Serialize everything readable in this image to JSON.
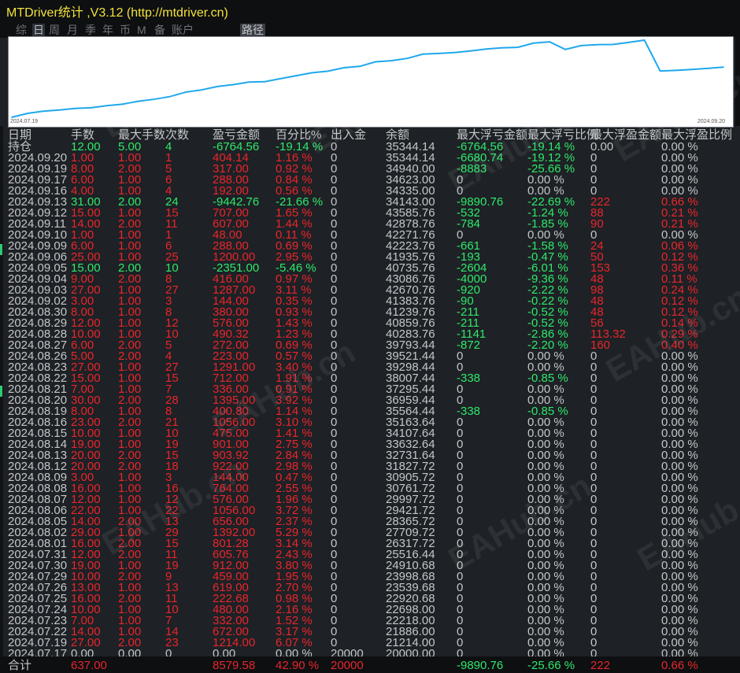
{
  "window": {
    "title": "MTDriver统计 ,V3.12 (http://mtdriver.cn)"
  },
  "tabs": [
    {
      "label": "综",
      "active": false
    },
    {
      "label": "日",
      "active": true
    },
    {
      "label": "周",
      "active": false
    },
    {
      "label": "月",
      "active": false
    },
    {
      "label": "季",
      "active": false
    },
    {
      "label": "年",
      "active": false
    },
    {
      "label": "币",
      "active": false
    },
    {
      "label": "M",
      "active": false
    },
    {
      "label": "备",
      "active": false
    },
    {
      "label": "账户",
      "active": false
    }
  ],
  "route_tab": "路径",
  "chart": {
    "start_date": "2024.07.19",
    "end_date": "2024.09.20",
    "line_color": "#1fa8ec",
    "balance": [
      20000.0,
      21214.0,
      21886.0,
      22218.0,
      22698.0,
      22920.68,
      23539.68,
      23998.68,
      24910.68,
      25516.44,
      26317.72,
      27709.72,
      28365.72,
      29421.72,
      29997.72,
      30761.72,
      30905.72,
      31827.72,
      32731.64,
      33632.64,
      34107.64,
      35163.64,
      35564.44,
      36959.44,
      37295.44,
      38007.44,
      39298.44,
      39521.44,
      39793.44,
      40283.76,
      40859.76,
      41239.76,
      41383.76,
      42670.76,
      43086.76,
      40735.76,
      41935.76,
      42223.76,
      42271.76,
      42878.76,
      43585.76,
      34143.0,
      34335.0,
      34623.0,
      34940.0,
      35344.14
    ]
  },
  "table": {
    "headers": [
      "日期",
      "手数",
      "最大手数",
      "次数",
      "盈亏金额",
      "百分比%",
      "出入金",
      "余额",
      "最大浮亏金额",
      "最大浮亏比例",
      "最大浮盈金额",
      "最大浮盈比例"
    ],
    "rows": [
      [
        "持仓",
        "12.00",
        "5.00",
        "4",
        "-6764.56",
        "-19.14 %",
        "0",
        "35344.14",
        "-6764.56",
        "-19.14 %",
        "0.00",
        "0.00 %"
      ],
      [
        "2024.09.20",
        "1.00",
        "1.00",
        "1",
        "404.14",
        "1.16 %",
        "0",
        "35344.14",
        "-6680.74",
        "-19.12 %",
        "0",
        "0.00 %"
      ],
      [
        "2024.09.19",
        "8.00",
        "2.00",
        "5",
        "317.00",
        "0.92 %",
        "0",
        "34940.00",
        "-8883",
        "-25.66 %",
        "0",
        "0.00 %"
      ],
      [
        "2024.09.17",
        "6.00",
        "1.00",
        "6",
        "288.00",
        "0.84 %",
        "0",
        "34623.00",
        "0",
        "0.00 %",
        "0",
        "0.00 %"
      ],
      [
        "2024.09.16",
        "4.00",
        "1.00",
        "4",
        "192.00",
        "0.56 %",
        "0",
        "34335.00",
        "0",
        "0.00 %",
        "0",
        "0.00 %"
      ],
      [
        "2024.09.13",
        "31.00",
        "2.00",
        "24",
        "-9442.76",
        "-21.66 %",
        "0",
        "34143.00",
        "-9890.76",
        "-22.69 %",
        "222",
        "0.66 %"
      ],
      [
        "2024.09.12",
        "15.00",
        "1.00",
        "15",
        "707.00",
        "1.65 %",
        "0",
        "43585.76",
        "-532",
        "-1.24 %",
        "88",
        "0.21 %"
      ],
      [
        "2024.09.11",
        "14.00",
        "2.00",
        "11",
        "607.00",
        "1.44 %",
        "0",
        "42878.76",
        "-784",
        "-1.85 %",
        "90",
        "0.21 %"
      ],
      [
        "2024.09.10",
        "1.00",
        "1.00",
        "1",
        "48.00",
        "0.11 %",
        "0",
        "42271.76",
        "0",
        "0.00 %",
        "0",
        "0.00 %"
      ],
      [
        "2024.09.09",
        "6.00",
        "1.00",
        "6",
        "288.00",
        "0.69 %",
        "0",
        "42223.76",
        "-661",
        "-1.58 %",
        "24",
        "0.06 %"
      ],
      [
        "2024.09.06",
        "25.00",
        "1.00",
        "25",
        "1200.00",
        "2.95 %",
        "0",
        "41935.76",
        "-193",
        "-0.47 %",
        "50",
        "0.12 %"
      ],
      [
        "2024.09.05",
        "15.00",
        "2.00",
        "10",
        "-2351.00",
        "-5.46 %",
        "0",
        "40735.76",
        "-2604",
        "-6.01 %",
        "153",
        "0.36 %"
      ],
      [
        "2024.09.04",
        "9.00",
        "2.00",
        "8",
        "416.00",
        "0.97 %",
        "0",
        "43086.76",
        "-4000",
        "-9.36 %",
        "48",
        "0.11 %"
      ],
      [
        "2024.09.03",
        "27.00",
        "1.00",
        "27",
        "1287.00",
        "3.11 %",
        "0",
        "42670.76",
        "-920",
        "-2.22 %",
        "98",
        "0.24 %"
      ],
      [
        "2024.09.02",
        "3.00",
        "1.00",
        "3",
        "144.00",
        "0.35 %",
        "0",
        "41383.76",
        "-90",
        "-0.22 %",
        "48",
        "0.12 %"
      ],
      [
        "2024.08.30",
        "8.00",
        "1.00",
        "8",
        "380.00",
        "0.93 %",
        "0",
        "41239.76",
        "-211",
        "-0.52 %",
        "48",
        "0.12 %"
      ],
      [
        "2024.08.29",
        "12.00",
        "1.00",
        "12",
        "576.00",
        "1.43 %",
        "0",
        "40859.76",
        "-211",
        "-0.52 %",
        "56",
        "0.14 %"
      ],
      [
        "2024.08.28",
        "10.00",
        "1.00",
        "10",
        "490.32",
        "1.23 %",
        "0",
        "40283.76",
        "-1141",
        "-2.86 %",
        "113.32",
        "0.29 %"
      ],
      [
        "2024.08.27",
        "6.00",
        "2.00",
        "5",
        "272.00",
        "0.69 %",
        "0",
        "39793.44",
        "-872",
        "-2.20 %",
        "160",
        "0.40 %"
      ],
      [
        "2024.08.26",
        "5.00",
        "2.00",
        "4",
        "223.00",
        "0.57 %",
        "0",
        "39521.44",
        "0",
        "0.00 %",
        "0",
        "0.00 %"
      ],
      [
        "2024.08.23",
        "27.00",
        "1.00",
        "27",
        "1291.00",
        "3.40 %",
        "0",
        "39298.44",
        "0",
        "0.00 %",
        "0",
        "0.00 %"
      ],
      [
        "2024.08.22",
        "15.00",
        "1.00",
        "15",
        "712.00",
        "1.91 %",
        "0",
        "38007.44",
        "-338",
        "-0.85 %",
        "0",
        "0.00 %"
      ],
      [
        "2024.08.21",
        "7.00",
        "1.00",
        "7",
        "336.00",
        "0.91 %",
        "0",
        "37295.44",
        "0",
        "0.00 %",
        "0",
        "0.00 %"
      ],
      [
        "2024.08.20",
        "30.00",
        "2.00",
        "28",
        "1395.00",
        "3.92 %",
        "0",
        "36959.44",
        "0",
        "0.00 %",
        "0",
        "0.00 %"
      ],
      [
        "2024.08.19",
        "8.00",
        "1.00",
        "8",
        "400.80",
        "1.14 %",
        "0",
        "35564.44",
        "-338",
        "-0.85 %",
        "0",
        "0.00 %"
      ],
      [
        "2024.08.16",
        "23.00",
        "2.00",
        "21",
        "1056.00",
        "3.10 %",
        "0",
        "35163.64",
        "0",
        "0.00 %",
        "0",
        "0.00 %"
      ],
      [
        "2024.08.15",
        "10.00",
        "1.00",
        "10",
        "475.00",
        "1.41 %",
        "0",
        "34107.64",
        "0",
        "0.00 %",
        "0",
        "0.00 %"
      ],
      [
        "2024.08.14",
        "19.00",
        "1.00",
        "19",
        "901.00",
        "2.75 %",
        "0",
        "33632.64",
        "0",
        "0.00 %",
        "0",
        "0.00 %"
      ],
      [
        "2024.08.13",
        "20.00",
        "2.00",
        "15",
        "903.92",
        "2.84 %",
        "0",
        "32731.64",
        "0",
        "0.00 %",
        "0",
        "0.00 %"
      ],
      [
        "2024.08.12",
        "20.00",
        "2.00",
        "18",
        "922.00",
        "2.98 %",
        "0",
        "31827.72",
        "0",
        "0.00 %",
        "0",
        "0.00 %"
      ],
      [
        "2024.08.09",
        "3.00",
        "1.00",
        "3",
        "144.00",
        "0.47 %",
        "0",
        "30905.72",
        "0",
        "0.00 %",
        "0",
        "0.00 %"
      ],
      [
        "2024.08.08",
        "16.00",
        "1.00",
        "16",
        "764.00",
        "2.55 %",
        "0",
        "30761.72",
        "0",
        "0.00 %",
        "0",
        "0.00 %"
      ],
      [
        "2024.08.07",
        "12.00",
        "1.00",
        "12",
        "576.00",
        "1.96 %",
        "0",
        "29997.72",
        "0",
        "0.00 %",
        "0",
        "0.00 %"
      ],
      [
        "2024.08.06",
        "22.00",
        "1.00",
        "22",
        "1056.00",
        "3.72 %",
        "0",
        "29421.72",
        "0",
        "0.00 %",
        "0",
        "0.00 %"
      ],
      [
        "2024.08.05",
        "14.00",
        "2.00",
        "13",
        "656.00",
        "2.37 %",
        "0",
        "28365.72",
        "0",
        "0.00 %",
        "0",
        "0.00 %"
      ],
      [
        "2024.08.02",
        "29.00",
        "1.00",
        "29",
        "1392.00",
        "5.29 %",
        "0",
        "27709.72",
        "0",
        "0.00 %",
        "0",
        "0.00 %"
      ],
      [
        "2024.08.01",
        "16.00",
        "2.00",
        "15",
        "801.28",
        "3.14 %",
        "0",
        "26317.72",
        "0",
        "0.00 %",
        "0",
        "0.00 %"
      ],
      [
        "2024.07.31",
        "12.00",
        "2.00",
        "11",
        "605.76",
        "2.43 %",
        "0",
        "25516.44",
        "0",
        "0.00 %",
        "0",
        "0.00 %"
      ],
      [
        "2024.07.30",
        "19.00",
        "1.00",
        "19",
        "912.00",
        "3.80 %",
        "0",
        "24910.68",
        "0",
        "0.00 %",
        "0",
        "0.00 %"
      ],
      [
        "2024.07.29",
        "10.00",
        "2.00",
        "9",
        "459.00",
        "1.95 %",
        "0",
        "23998.68",
        "0",
        "0.00 %",
        "0",
        "0.00 %"
      ],
      [
        "2024.07.26",
        "13.00",
        "1.00",
        "13",
        "619.00",
        "2.70 %",
        "0",
        "23539.68",
        "0",
        "0.00 %",
        "0",
        "0.00 %"
      ],
      [
        "2024.07.25",
        "16.00",
        "2.00",
        "11",
        "222.68",
        "0.98 %",
        "0",
        "22920.68",
        "0",
        "0.00 %",
        "0",
        "0.00 %"
      ],
      [
        "2024.07.24",
        "10.00",
        "1.00",
        "10",
        "480.00",
        "2.16 %",
        "0",
        "22698.00",
        "0",
        "0.00 %",
        "0",
        "0.00 %"
      ],
      [
        "2024.07.23",
        "7.00",
        "1.00",
        "7",
        "332.00",
        "1.52 %",
        "0",
        "22218.00",
        "0",
        "0.00 %",
        "0",
        "0.00 %"
      ],
      [
        "2024.07.22",
        "14.00",
        "1.00",
        "14",
        "672.00",
        "3.17 %",
        "0",
        "21886.00",
        "0",
        "0.00 %",
        "0",
        "0.00 %"
      ],
      [
        "2024.07.19",
        "27.00",
        "2.00",
        "23",
        "1214.00",
        "6.07 %",
        "0",
        "21214.00",
        "0",
        "0.00 %",
        "0",
        "0.00 %"
      ],
      [
        "2024.07.17",
        "0.00",
        "0.00",
        "0",
        "0.00",
        "0.00 %",
        "20000",
        "20000.00",
        "0",
        "0.00 %",
        "0",
        "0.00 %"
      ]
    ],
    "totals": [
      "合计",
      "637.00",
      "",
      "",
      "8579.58",
      "42.90 %",
      "20000",
      "",
      "-9890.76",
      "-25.66 %",
      "222",
      "0.66 %"
    ]
  },
  "watermark": "EAHub.cn",
  "colors": {
    "profit": "#e8262c",
    "loss": "#2ee86b",
    "neutral": "#c4c7ca",
    "title": "#f2e23a"
  }
}
